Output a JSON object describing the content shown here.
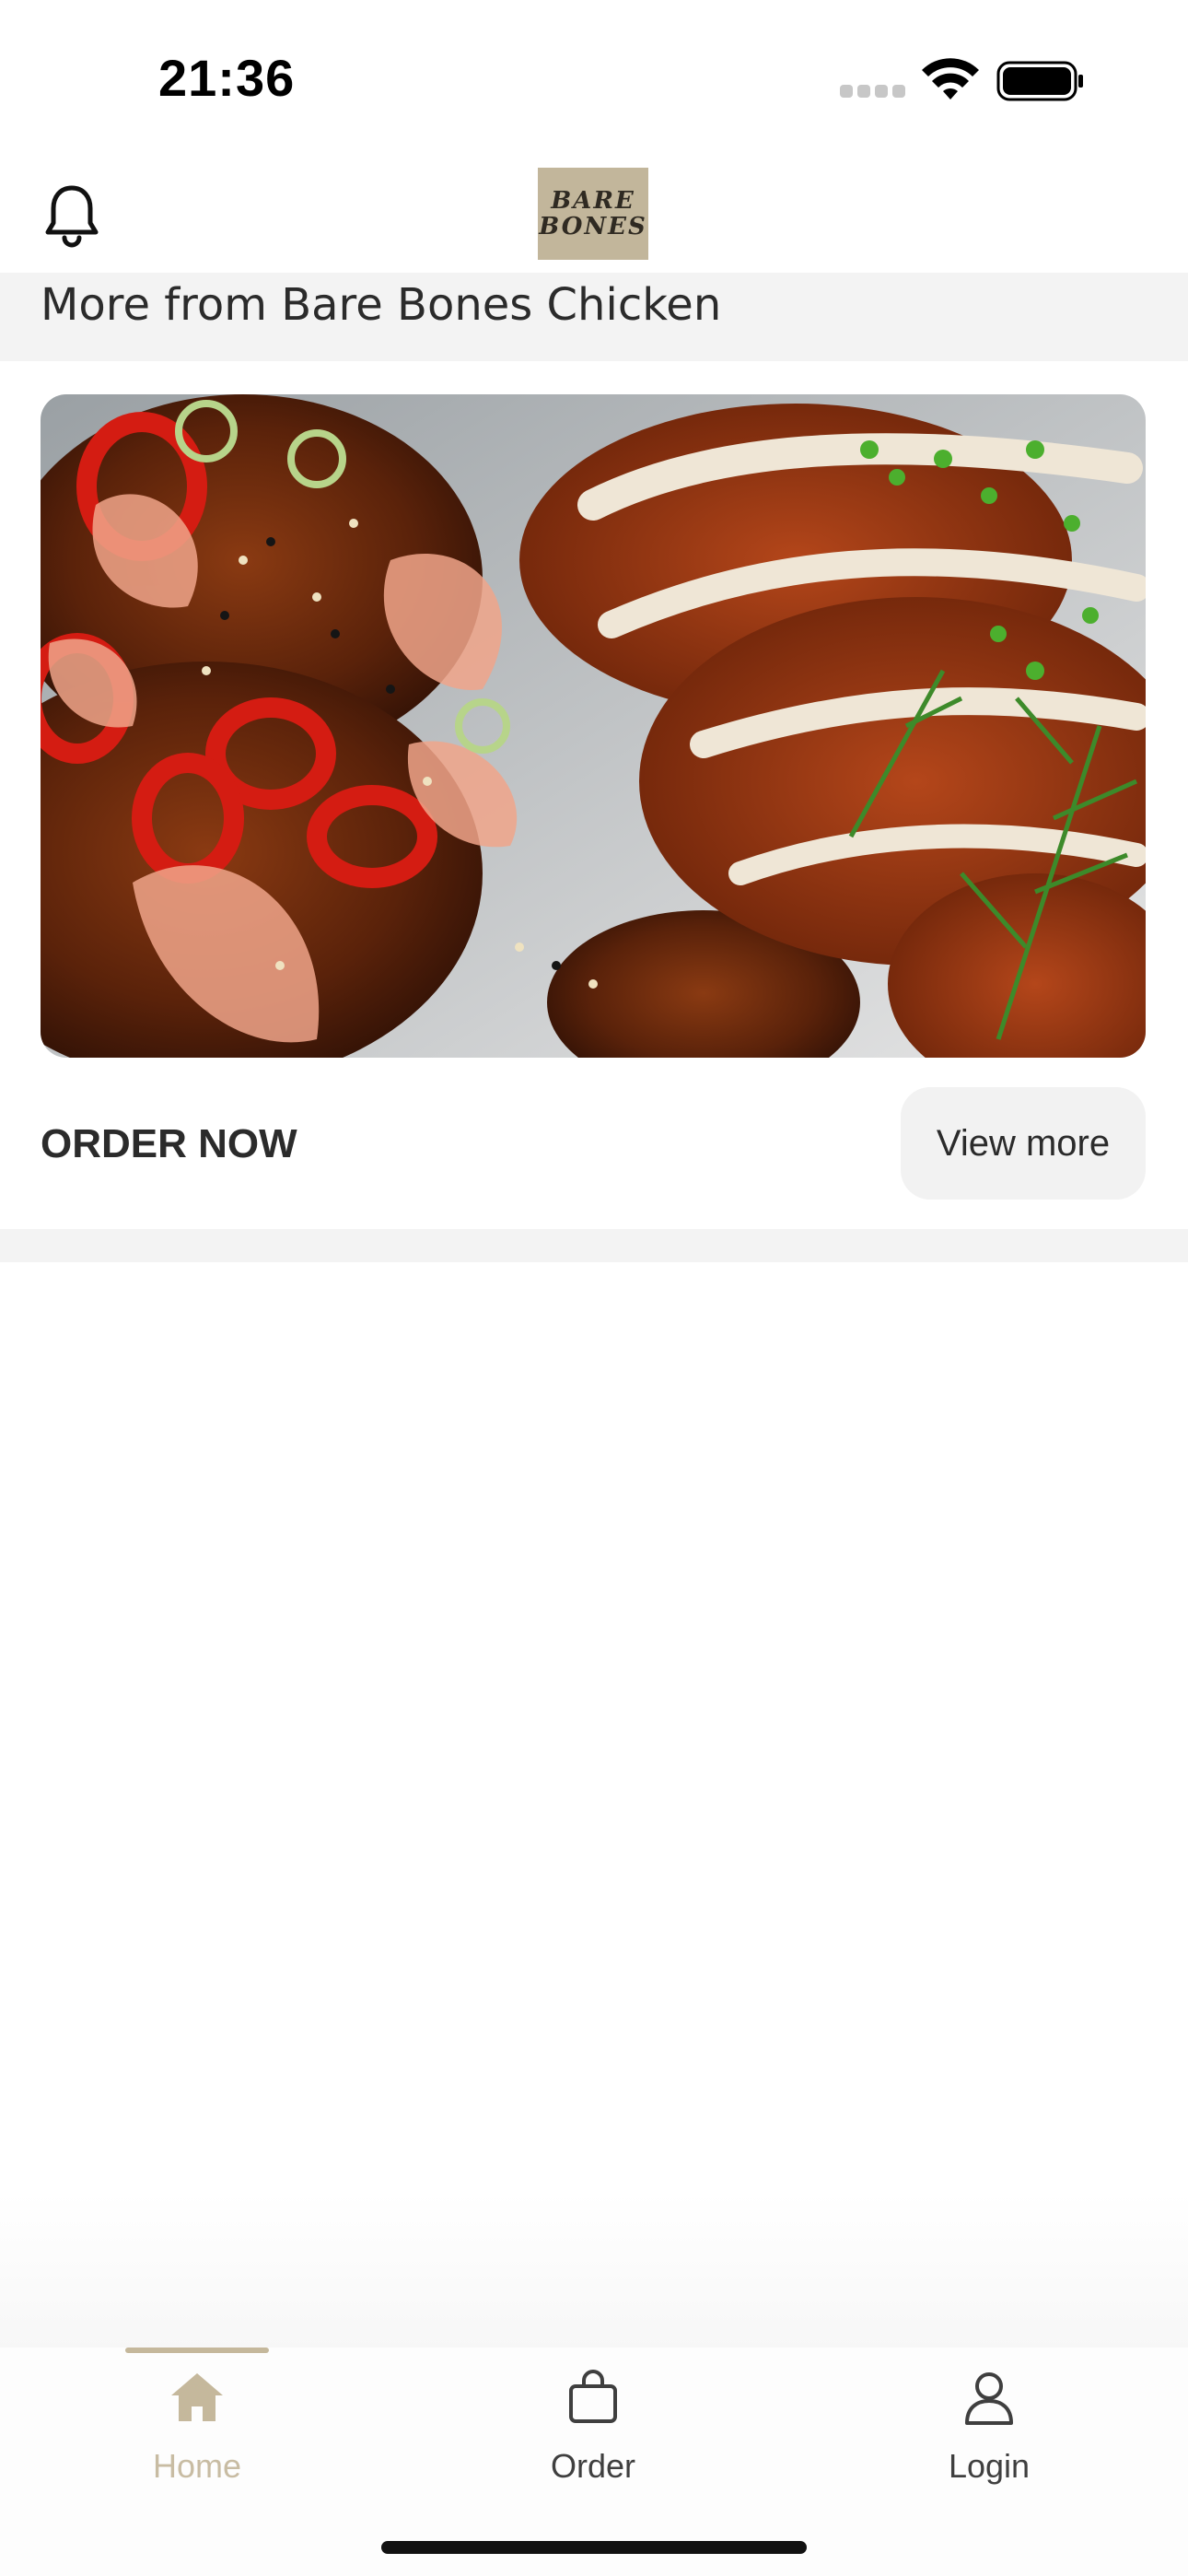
{
  "status_bar": {
    "time": "21:36",
    "icons": [
      "cellular-signal-icon",
      "wifi-icon",
      "battery-icon"
    ]
  },
  "header": {
    "logo_line1": "BARE",
    "logo_line2": "BONES",
    "bell_icon": "bell-icon",
    "logo_color": "#c2b69b"
  },
  "section": {
    "title": "More from Bare Bones Chicken"
  },
  "promo": {
    "cta_label": "ORDER NOW",
    "view_more_label": "View more"
  },
  "tab_bar": {
    "tabs": [
      {
        "label": "Home",
        "icon": "home-icon",
        "active": true
      },
      {
        "label": "Order",
        "icon": "shopping-bag-icon",
        "active": false
      },
      {
        "label": "Login",
        "icon": "user-icon",
        "active": false
      }
    ],
    "active_color": "#c5b89c"
  }
}
